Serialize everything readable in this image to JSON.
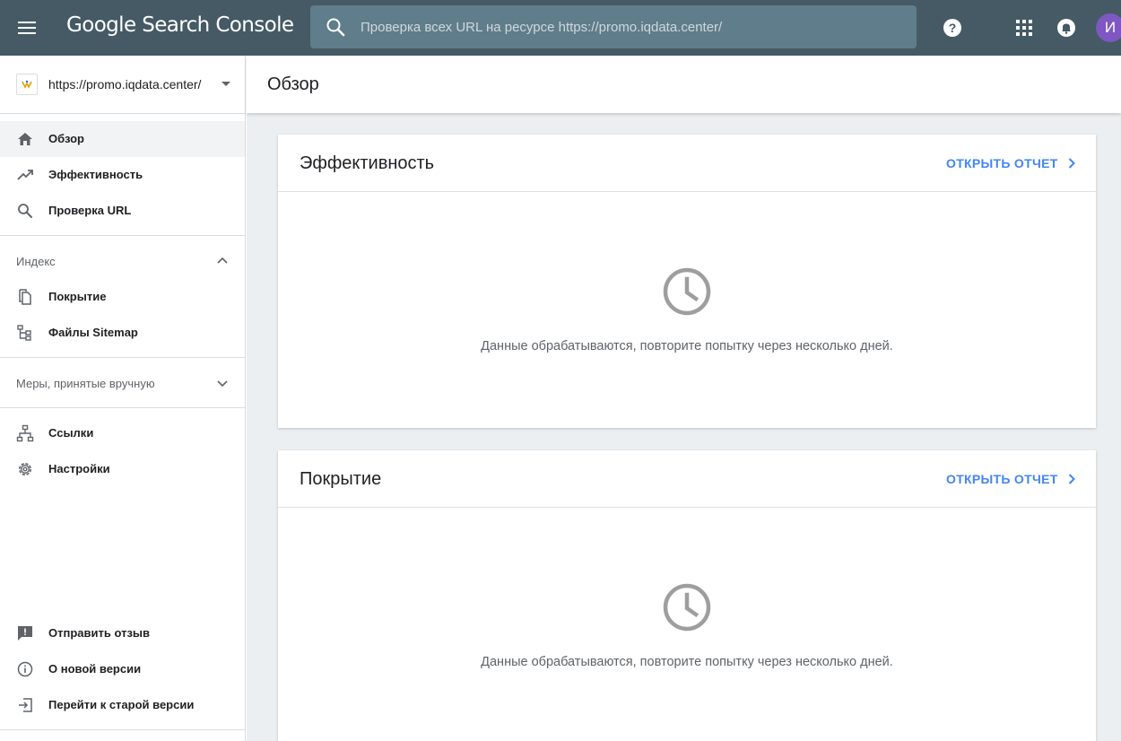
{
  "app": {
    "title": "Google Search Console",
    "user_initial": "И"
  },
  "search": {
    "placeholder": "Проверка всех URL на ресурсе https://promo.iqdata.center/"
  },
  "property": {
    "url": "https://promo.iqdata.center/"
  },
  "sidebar": {
    "main_items": [
      {
        "label": "Обзор",
        "icon": "home-icon",
        "active": true
      },
      {
        "label": "Эффективность",
        "icon": "trending-up-icon"
      },
      {
        "label": "Проверка URL",
        "icon": "search-icon"
      }
    ],
    "index_section": {
      "label": "Индекс",
      "items": [
        {
          "label": "Покрытие",
          "icon": "file-copy-icon"
        },
        {
          "label": "Файлы Sitemap",
          "icon": "sitemap-icon"
        }
      ]
    },
    "manual_section": {
      "label": "Меры, принятые вручную"
    },
    "other_items": [
      {
        "label": "Ссылки",
        "icon": "links-icon"
      },
      {
        "label": "Настройки",
        "icon": "gear-icon"
      }
    ],
    "footer_items": [
      {
        "label": "Отправить отзыв",
        "icon": "feedback-icon"
      },
      {
        "label": "О новой версии",
        "icon": "info-icon"
      },
      {
        "label": "Перейти к старой версии",
        "icon": "exit-icon"
      }
    ]
  },
  "page": {
    "title": "Обзор"
  },
  "cards": [
    {
      "title": "Эффективность",
      "link": "ОТКРЫТЬ ОТЧЕТ",
      "message": "Данные обрабатываются, повторите попытку через несколько дней."
    },
    {
      "title": "Покрытие",
      "link": "ОТКРЫТЬ ОТЧЕТ",
      "message": "Данные обрабатываются, повторите попытку через несколько дней."
    }
  ],
  "colors": {
    "topbar": "#455a64",
    "search_bg": "#607d8b",
    "accent_link": "#4285f4",
    "avatar": "#7e57c2"
  }
}
